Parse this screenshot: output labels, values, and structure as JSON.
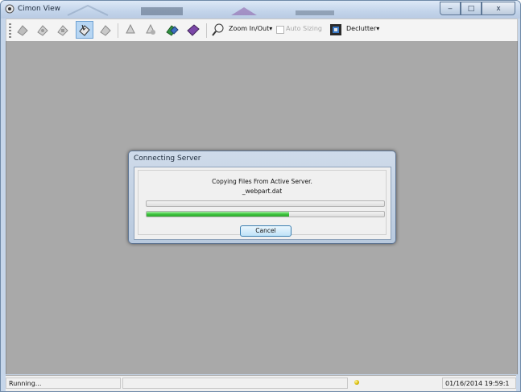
{
  "window": {
    "title": "Cimon View",
    "caption_buttons": {
      "minimize": "‒",
      "maximize": "□",
      "close": "x"
    }
  },
  "toolbar": {
    "zoom_label": "Zoom In/Out",
    "dropdown_arrow": "▾",
    "auto_sizing_label": "Auto Sizing",
    "auto_sizing_checked": false,
    "declutter_label": "Declutter",
    "icons": [
      "stamp-icon",
      "stamp-icon",
      "stamp-icon",
      "select-tool-icon",
      "stamp-icon",
      "stamp-icon",
      "stamp-icon",
      "layers-icon",
      "diamond-icon",
      "zoom-icon",
      "declutter-icon"
    ],
    "active_tool_index": 3
  },
  "dialog": {
    "title": "Connecting Server",
    "message": "Copying Files From Active Server.",
    "filename": "_webpart.dat",
    "progress_overall": 0,
    "progress_file": 0.6,
    "cancel_label": "Cancel"
  },
  "statusbar": {
    "status": "Running...",
    "datetime": "01/16/2014 19:59:1",
    "led_color": "#d6b800"
  },
  "colors": {
    "workspace": "#a9a9a9",
    "progress": "#3fc43f",
    "accent": "#6ea1d2"
  }
}
